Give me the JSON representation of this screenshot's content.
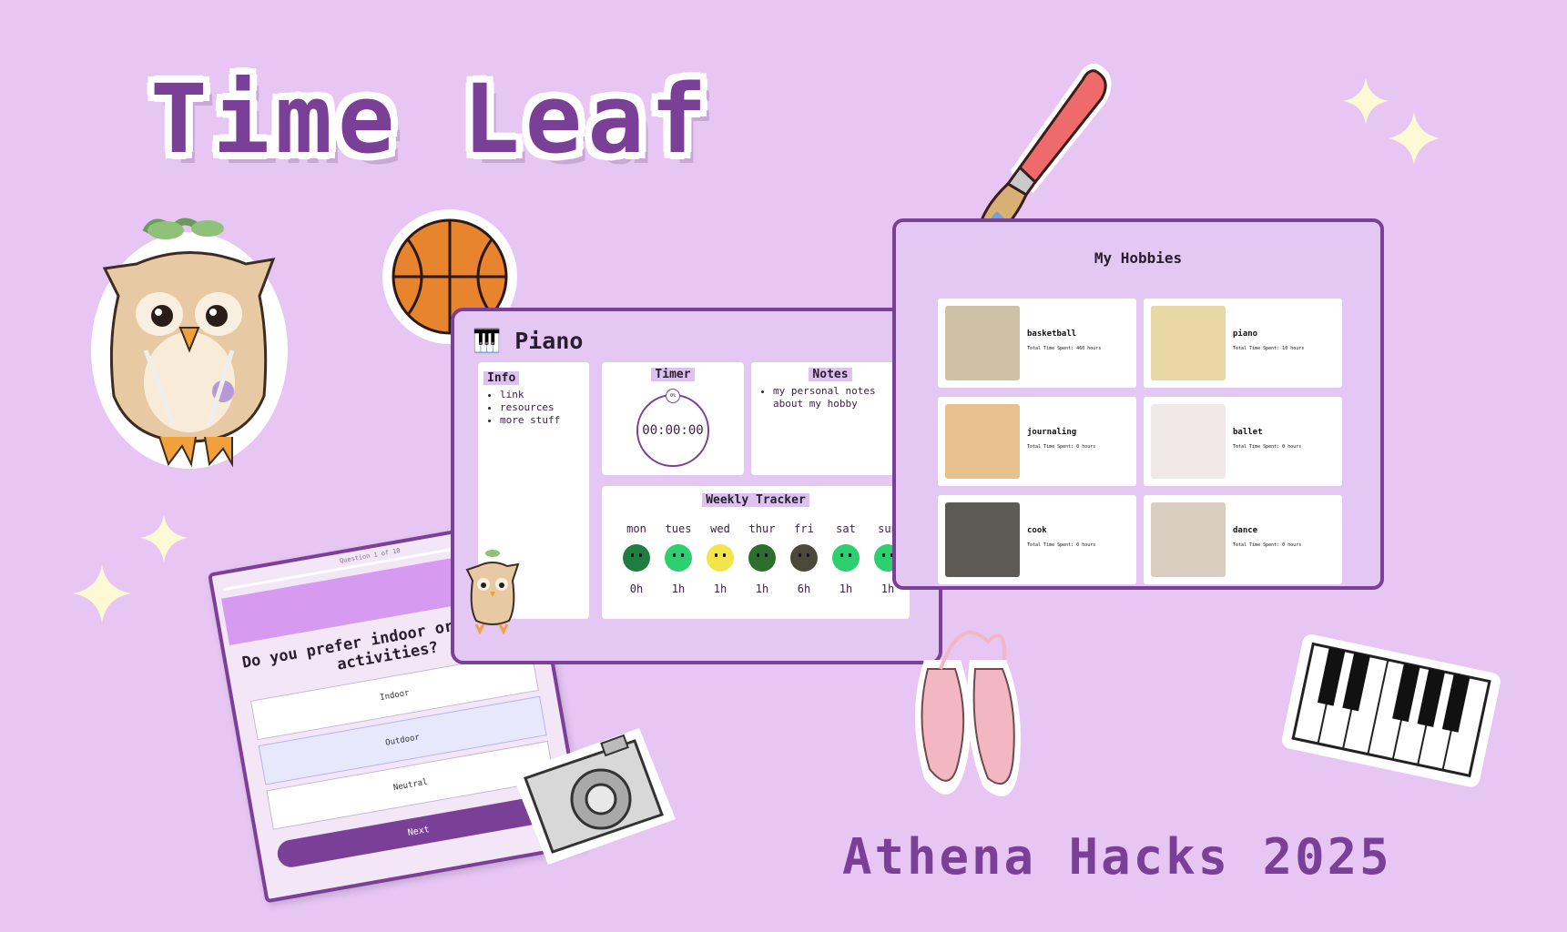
{
  "title": "Time Leaf",
  "footer": "Athena Hacks 2025",
  "colors": {
    "background": "#e7c6f4",
    "accent": "#7a3f96",
    "panel": "#e4c8f3"
  },
  "quiz": {
    "progress": "Question 1 of 10",
    "question": "Do you prefer indoor or outdoor activities?",
    "options": [
      "Indoor",
      "Outdoor",
      "Neutral"
    ],
    "selected": "Outdoor",
    "next_label": "Next"
  },
  "piano_window": {
    "icon": "piano-keys-icon",
    "title": "Piano",
    "info": {
      "heading": "Info",
      "items": [
        "link",
        "resources",
        "more stuff"
      ]
    },
    "timer": {
      "heading": "Timer",
      "value": "00:00:00",
      "badge": "0%"
    },
    "notes": {
      "heading": "Notes",
      "items": [
        "my personal notes about my hobby"
      ]
    },
    "tracker": {
      "heading": "Weekly Tracker",
      "days": [
        {
          "day": "mon",
          "hours": "0h",
          "mood": "neutral",
          "color": "#1f7d3f"
        },
        {
          "day": "tues",
          "hours": "1h",
          "mood": "happy",
          "color": "#2ecf6e"
        },
        {
          "day": "wed",
          "hours": "1h",
          "mood": "happy",
          "color": "#f1e54a"
        },
        {
          "day": "thur",
          "hours": "1h",
          "mood": "sad",
          "color": "#2c6e2e"
        },
        {
          "day": "fri",
          "hours": "6h",
          "mood": "shocked",
          "color": "#4b4a3a"
        },
        {
          "day": "sat",
          "hours": "1h",
          "mood": "happy",
          "color": "#2ecf6e"
        },
        {
          "day": "sun",
          "hours": "1h",
          "mood": "happy",
          "color": "#2ecf6e"
        }
      ]
    }
  },
  "hobbies_window": {
    "title": "My Hobbies",
    "items": [
      {
        "name": "basketball",
        "total": "Total Time Spent: 460 hours"
      },
      {
        "name": "piano",
        "total": "Total Time Spent: 10 hours"
      },
      {
        "name": "journaling",
        "total": "Total Time Spent: 0 hours"
      },
      {
        "name": "ballet",
        "total": "Total Time Spent: 0 hours"
      },
      {
        "name": "cook",
        "total": "Total Time Spent: 0 hours"
      },
      {
        "name": "dance",
        "total": "Total Time Spent: 0 hours"
      }
    ]
  },
  "stickers": [
    "owl-knitting-sticker",
    "basketball-sticker",
    "paintbrush-sticker",
    "camera-sticker",
    "ballet-shoes-sticker",
    "piano-sticker",
    "sparkle-icon"
  ]
}
